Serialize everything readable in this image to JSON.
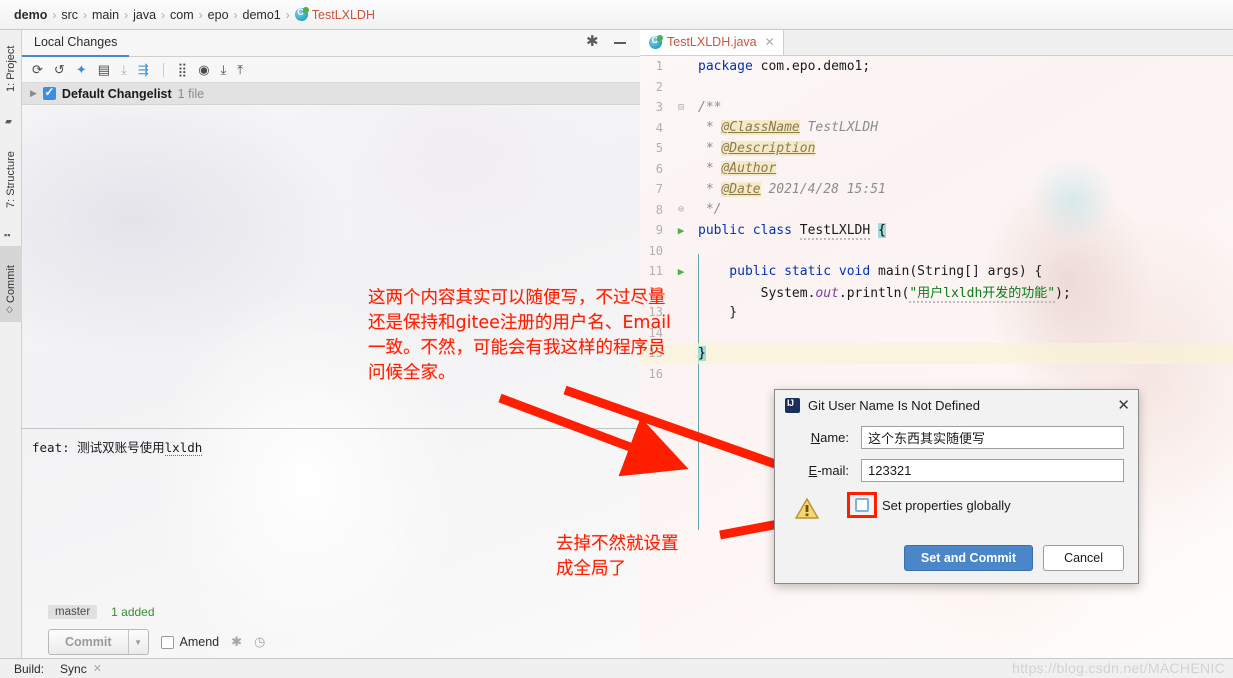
{
  "breadcrumb": {
    "items": [
      "demo",
      "src",
      "main",
      "java",
      "com",
      "epo",
      "demo1"
    ],
    "file": "TestLXLDH.java_label",
    "file_label": "TestLXLDH",
    "separator": "›"
  },
  "tool_strip": {
    "project": "1: Project",
    "structure": "7: Structure",
    "commit": "Commit"
  },
  "left_panel": {
    "tab_label": "Local Changes",
    "changelist": {
      "name": "Default Changelist",
      "count": "1 file"
    },
    "toolbar_icons": [
      "refresh-icon",
      "rollback-icon",
      "diff-icon",
      "show-diff-icon",
      "update-icon",
      "shelve-icon",
      "group-by-icon",
      "preview-icon",
      "expand-all-icon",
      "collapse-all-icon"
    ]
  },
  "commit": {
    "message": "feat: 测试双账号使用lxldh",
    "message_plain": "feat: 测试双账号使用",
    "message_underlined": "lxldh",
    "branch": "master",
    "added": "1 added",
    "commit_button": "Commit",
    "amend_label": "Amend"
  },
  "editor": {
    "tab_label": "TestLXLDH.java",
    "lines": [
      {
        "num": "1",
        "gutter": ""
      },
      {
        "num": "2",
        "gutter": ""
      },
      {
        "num": "3",
        "gutter": "fold"
      },
      {
        "num": "4",
        "gutter": ""
      },
      {
        "num": "5",
        "gutter": ""
      },
      {
        "num": "6",
        "gutter": ""
      },
      {
        "num": "7",
        "gutter": ""
      },
      {
        "num": "8",
        "gutter": "fold"
      },
      {
        "num": "9",
        "gutter": "run"
      },
      {
        "num": "10",
        "gutter": ""
      },
      {
        "num": "11",
        "gutter": "run"
      },
      {
        "num": "12",
        "gutter": ""
      },
      {
        "num": "13",
        "gutter": ""
      },
      {
        "num": "14",
        "gutter": ""
      },
      {
        "num": "15",
        "gutter": ""
      },
      {
        "num": "16",
        "gutter": ""
      }
    ],
    "code": {
      "l1_kw": "package",
      "l1_rest": " com.epo.demo1;",
      "l3": "/**",
      "l4_star": " * ",
      "l4_tag": "@ClassName",
      "l4_rest": " TestLXLDH",
      "l5_star": " * ",
      "l5_tag": "@Description",
      "l6_star": " * ",
      "l6_tag": "@Author",
      "l7_star": " * ",
      "l7_tag": "@Date",
      "l7_rest": " 2021/4/28 15:51",
      "l8": " */",
      "l9_kw1": "public",
      "l9_kw2": " class ",
      "l9_name": "TestLXLDH",
      "l9_brace": "{",
      "l11_kw": "    public static void ",
      "l11_name": "main",
      "l11_params": "(String[] args) {",
      "l12_a": "        System.",
      "l12_out": "out",
      "l12_b": ".println(",
      "l12_str": "\"用户lxldh开发的功能\"",
      "l12_c": ");",
      "l13": "    }",
      "l15": "}"
    }
  },
  "annotations": {
    "main": "这两个内容其实可以随便写，不过尽量\n还是保持和gitee注册的用户名、Email\n一致。不然，可能会有我这样的程序员\n问候全家。",
    "checkbox": "去掉不然就设置\n成全局了"
  },
  "dialog": {
    "title": "Git User Name Is Not Defined",
    "close": "✕",
    "name_label_accel": "N",
    "name_label_rest": "ame:",
    "name_value": "这个东西其实随便写",
    "email_label_accel": "E",
    "email_label_rest": "-mail:",
    "email_value": "123321",
    "checkbox_label_a": "Set properties ",
    "checkbox_label_accel": "g",
    "checkbox_label_b": "lobally",
    "checkbox_checked": false,
    "primary_button": "Set and Commit",
    "cancel_button": "Cancel"
  },
  "status_bar": {
    "build_label": "Build:",
    "build_task": "Sync",
    "close": "✕"
  },
  "watermark": "https://blog.csdn.net/MACHENIC",
  "colors": {
    "accent_blue": "#4a86c8",
    "annotation_red": "#ff1f00",
    "keyword_blue": "#0033b3",
    "string_green": "#067d17",
    "added_green": "#3a8a3a",
    "tab_orange": "#c8553d"
  }
}
